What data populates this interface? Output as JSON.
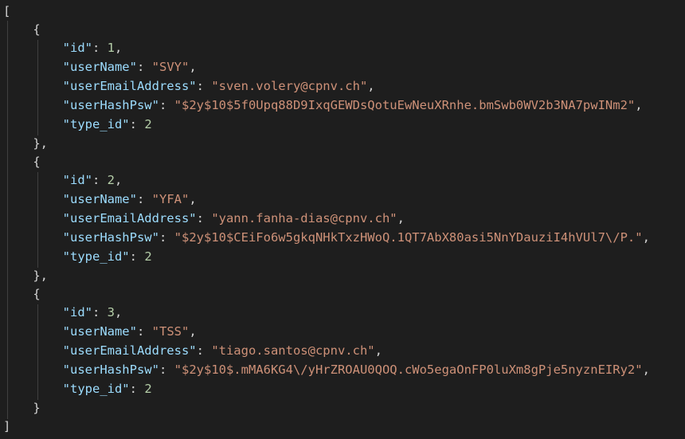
{
  "colors": {
    "background": "#1e1e1e",
    "punctuation": "#d4d4d4",
    "key": "#9cdcfe",
    "string": "#ce9178",
    "number": "#b5cea8",
    "indent_guide": "#404040"
  },
  "document": {
    "open_array": "[",
    "close_array": "]",
    "open_object": "{",
    "close_object_comma": "},",
    "close_object": "}",
    "records": [
      {
        "id_key": "\"id\"",
        "id_value": "1",
        "username_key": "\"userName\"",
        "username_value": "\"SVY\"",
        "email_key": "\"userEmailAddress\"",
        "email_value": "\"sven.volery@cpnv.ch\"",
        "hash_key": "\"userHashPsw\"",
        "hash_value": "\"$2y$10$5f0Upq88D9IxqGEWDsQotuEwNeuXRnhe.bmSwb0WV2b3NA7pwINm2\"",
        "type_key": "\"type_id\"",
        "type_value": "2"
      },
      {
        "id_key": "\"id\"",
        "id_value": "2",
        "username_key": "\"userName\"",
        "username_value": "\"YFA\"",
        "email_key": "\"userEmailAddress\"",
        "email_value": "\"yann.fanha-dias@cpnv.ch\"",
        "hash_key": "\"userHashPsw\"",
        "hash_value": "\"$2y$10$CEiFo6w5gkqNHkTxzHWoQ.1QT7AbX80asi5NnYDauziI4hVUl7\\/P.\"",
        "type_key": "\"type_id\"",
        "type_value": "2"
      },
      {
        "id_key": "\"id\"",
        "id_value": "3",
        "username_key": "\"userName\"",
        "username_value": "\"TSS\"",
        "email_key": "\"userEmailAddress\"",
        "email_value": "\"tiago.santos@cpnv.ch\"",
        "hash_key": "\"userHashPsw\"",
        "hash_value": "\"$2y$10$.mMA6KG4\\/yHrZROAU0QOQ.cWo5egaOnFP0luXm8gPje5nyznEIRy2\"",
        "type_key": "\"type_id\"",
        "type_value": "2"
      }
    ]
  }
}
